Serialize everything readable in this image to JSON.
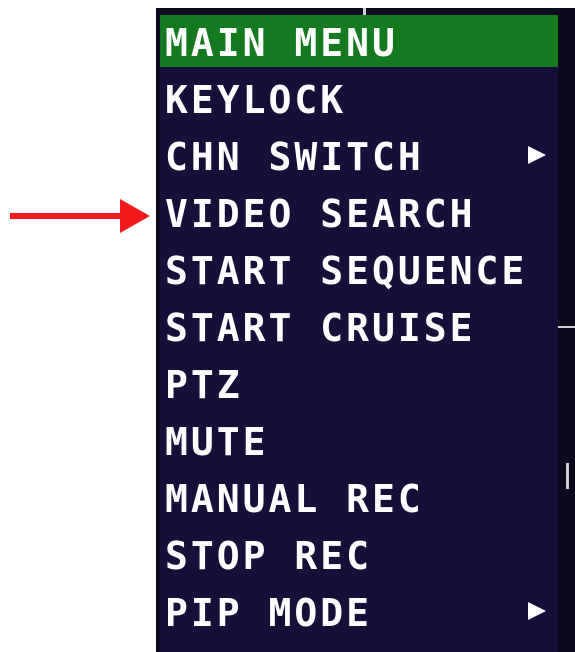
{
  "menu": {
    "title": "MAIN MENU",
    "items": [
      {
        "label": "KEYLOCK",
        "has_submenu": false
      },
      {
        "label": "CHN SWITCH",
        "has_submenu": true
      },
      {
        "label": "VIDEO SEARCH",
        "has_submenu": false
      },
      {
        "label": "START SEQUENCE",
        "has_submenu": false
      },
      {
        "label": "START CRUISE",
        "has_submenu": false
      },
      {
        "label": "PTZ",
        "has_submenu": false
      },
      {
        "label": "MUTE",
        "has_submenu": false
      },
      {
        "label": "MANUAL REC",
        "has_submenu": false
      },
      {
        "label": "STOP REC",
        "has_submenu": false
      },
      {
        "label": "PIP MODE",
        "has_submenu": true
      }
    ],
    "highlighted_item": "VIDEO SEARCH",
    "submenu_icon": "triangle-right-icon"
  },
  "annotation": {
    "icon": "red-arrow-icon",
    "color": "#f21a1a",
    "points_to": "VIDEO SEARCH"
  },
  "colors": {
    "header_bg": "#157a1f",
    "menu_bg": "#14103a",
    "text": "#ffffff"
  }
}
